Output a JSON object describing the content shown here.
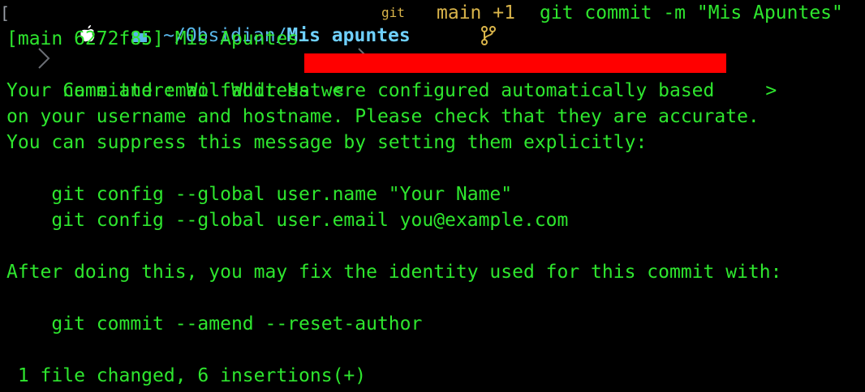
{
  "prompt": {
    "bracket": "[",
    "path_prefix": "~/Obsidian/",
    "path_current": "Mis apuntes",
    "git_label": "git",
    "branch": "main +1",
    "command": "git commit -m \"Mis Apuntes\""
  },
  "output": {
    "line1": "[main 6272f85] Mis Apuntes",
    "committer_prefix": " Committer: WolfWhiteHat <",
    "committer_suffix": ">",
    "line3": "Your name and email address were configured automatically based",
    "line4": "on your username and hostname. Please check that they are accurate.",
    "line5": "You can suppress this message by setting them explicitly:",
    "line6": "    git config --global user.name \"Your Name\"",
    "line7": "    git config --global user.email you@example.com",
    "line8": "After doing this, you may fix the identity used for this commit with:",
    "line9": "    git commit --amend --reset-author",
    "line10": " 1 file changed, 6 insertions(+)"
  },
  "colors": {
    "background": "#000000",
    "text": "#2ee62e",
    "path": "#58b6e8",
    "branch": "#d9b44a",
    "redaction": "#ff0000"
  },
  "icons": [
    "apple-icon",
    "chevron-right-icon",
    "folder-icon",
    "git-branch-icon"
  ]
}
